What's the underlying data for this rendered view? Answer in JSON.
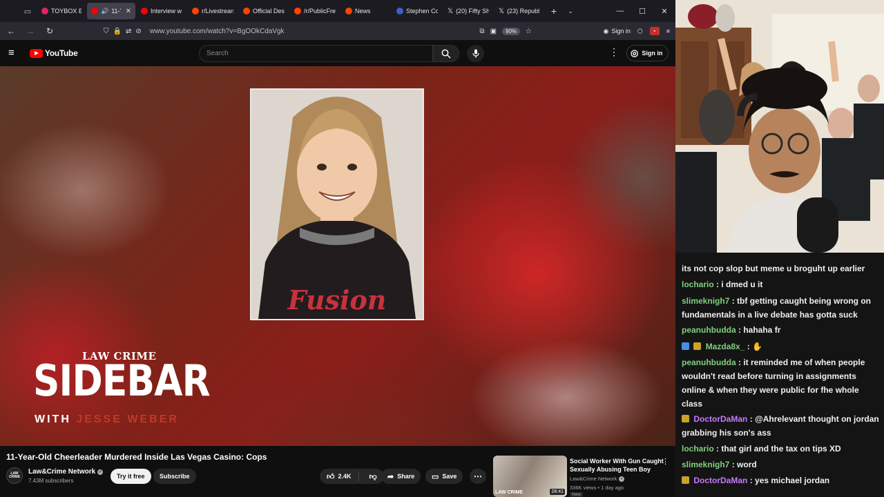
{
  "browser": {
    "tabs": [
      {
        "label": "TOYBOX BE",
        "favicon_color": "#e0245e",
        "active": false
      },
      {
        "label": "11-Y",
        "favicon_color": "#ff0000",
        "active": true
      },
      {
        "label": "Interview w",
        "favicon_color": "#ff0000",
        "active": false
      },
      {
        "label": "r/Livestrean",
        "favicon_color": "#ff4500",
        "active": false
      },
      {
        "label": "Official Des",
        "favicon_color": "#ff4500",
        "active": false
      },
      {
        "label": "/r/PublicFre",
        "favicon_color": "#ff4500",
        "active": false
      },
      {
        "label": "News",
        "favicon_color": "#ff4500",
        "active": false
      },
      {
        "label": "Stephen Co",
        "favicon_color": "#3a5fcd",
        "active": false
      },
      {
        "label": "(20) Fifty Sh",
        "favicon_color": "#ffffff",
        "active": false
      },
      {
        "label": "(23) Republ",
        "favicon_color": "#ffffff",
        "active": false
      }
    ],
    "url": "www.youtube.com/watch?v=BgOOkCdaVgk",
    "zoom": "90%",
    "signin_label": "Sign in"
  },
  "youtube": {
    "logo_text": "YouTube",
    "search_placeholder": "Search",
    "signin_label": "Sign in",
    "video": {
      "overlay_brand_top": "LAW  CRIME",
      "overlay_brand_main": "SIDEBAR",
      "overlay_with": "WITH",
      "overlay_host": "JESSE WEBER",
      "jersey_text": "Fusion",
      "title": "11-Year-Old Cheerleader Murdered Inside Las Vegas Casino: Cops"
    },
    "channel": {
      "avatar_text": "LAW CRIME",
      "name": "Law&Crime Network",
      "subscribers": "7.43M subscribers",
      "try_label": "Try it free",
      "subscribe_label": "Subscribe"
    },
    "actions": {
      "likes": "2.4K",
      "share_label": "Share",
      "save_label": "Save"
    },
    "recommendation": {
      "title": "Social Worker With Gun Caught Sexually Abusing Teen Boy",
      "channel": "Law&Crime Network",
      "meta": "336K views • 1 day ago",
      "badge": "New",
      "duration": "28:41",
      "thumb_brand": "LAW CRIME"
    }
  },
  "chat": {
    "messages": [
      {
        "user": "",
        "text": "its not cop slop but meme u broguht up earlier",
        "color": "#f0f0f0",
        "badge": ""
      },
      {
        "user": "lochario",
        "text": ": i dmed u it",
        "color": "#7fd07f",
        "badge": ""
      },
      {
        "user": "slimeknigh7",
        "text": ": tbf getting caught being wrong on fundamentals in a live debate has gotta suck",
        "color": "#7fd07f",
        "badge": ""
      },
      {
        "user": "peanuhbudda",
        "text": ": hahaha fr",
        "color": "#7fd07f",
        "badge": ""
      },
      {
        "user": "Mazda8x_",
        "text": ":",
        "color": "#7fd07f",
        "badge": "#4a90e2"
      },
      {
        "user": "peanuhbudda",
        "text": ": it reminded me of when people wouldn't read before turning in assignments online & when they were public for fhe whole class",
        "color": "#7fd07f",
        "badge": ""
      },
      {
        "user": "DoctorDaMan",
        "text": ": @Ahrelevant thought on jordan grabbing his son's ass",
        "color": "#c879ff",
        "badge": "#c9a227"
      },
      {
        "user": "lochario",
        "text": ": that girl and the tax on tips XD",
        "color": "#7fd07f",
        "badge": ""
      },
      {
        "user": "slimeknigh7",
        "text": ": word",
        "color": "#7fd07f",
        "badge": ""
      },
      {
        "user": "DoctorDaMan",
        "text": ": yes michael jordan",
        "color": "#c879ff",
        "badge": "#c9a227"
      }
    ]
  }
}
